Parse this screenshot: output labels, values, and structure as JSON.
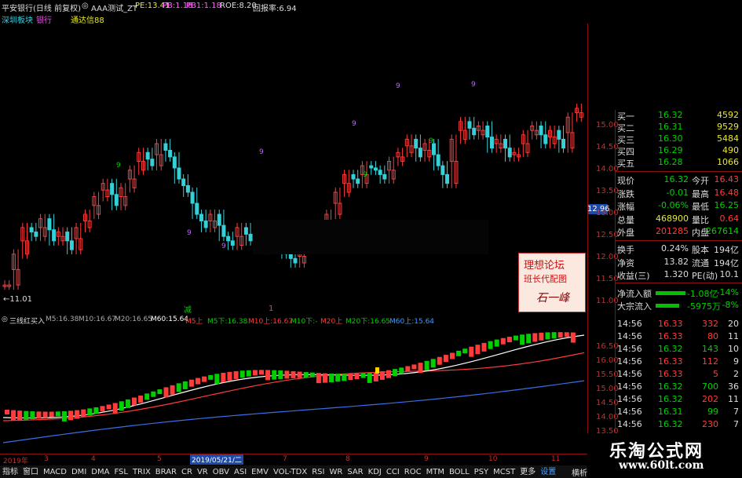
{
  "header": {
    "stock_title": "平安银行(日线 前复权)",
    "indicator_name": "AAA测试_ZT",
    "pe": "PE:13.41",
    "pb": "PB:1.18",
    "pb1": "PB1:1.18",
    "roe": "ROE:8.20",
    "ratio": "回报率:6.94",
    "sector": "深圳板块",
    "industry": "银行",
    "tdx_label": "通达信88"
  },
  "main_chart": {
    "y_ticks": [
      "15.00",
      "14.50",
      "14.00",
      "13.50",
      "13.00",
      "12.50",
      "12.00",
      "11.50",
      "11.00"
    ],
    "current_price_tag": "12.96",
    "low_label": "←11.01",
    "markers": [
      "9",
      "9",
      "9",
      "9",
      "9",
      "9",
      "9",
      "9",
      "9"
    ],
    "bottom_markers": [
      "减",
      "1"
    ]
  },
  "sub_chart": {
    "title": "三线红买入",
    "m5": "M5:16.38",
    "m10": "M10:16.67",
    "m20": "M20:16.65",
    "m60": "M60:15.64",
    "m5up": "M5上",
    "m5down": "M5下:16.38",
    "m10up": "M10上:16.67",
    "m10down": "M10下:-",
    "m20up": "M20上",
    "m20down": "M20下:16.65",
    "m60up": "M60上:15.64",
    "y_ticks": [
      "16.50",
      "16.00",
      "15.50",
      "15.00",
      "14.50",
      "14.00",
      "13.50"
    ]
  },
  "time_axis": {
    "labels": [
      "2019年",
      "3",
      "4",
      "5",
      "2019/05/21/二",
      "7",
      "8",
      "9",
      "10",
      "11"
    ]
  },
  "order_book": {
    "rows": [
      {
        "label": "买一",
        "price": "16.32",
        "vol": "4592"
      },
      {
        "label": "买二",
        "price": "16.31",
        "vol": "9529"
      },
      {
        "label": "买三",
        "price": "16.30",
        "vol": "5484"
      },
      {
        "label": "买四",
        "price": "16.29",
        "vol": "490"
      },
      {
        "label": "买五",
        "price": "16.28",
        "vol": "1066"
      }
    ],
    "right_ticks": [
      "15.00",
      "14.50",
      "14.00",
      "13.50",
      "13.00",
      "12.50",
      "12.00",
      "11.50",
      "11.00"
    ]
  },
  "quote": {
    "rows": [
      {
        "l1": "现价",
        "v1": "16.32",
        "l2": "今开",
        "v2": "16.43"
      },
      {
        "l1": "涨跌",
        "v1": "-0.01",
        "l2": "最高",
        "v2": "16.48"
      },
      {
        "l1": "涨幅",
        "v1": "-0.06%",
        "l2": "最低",
        "v2": "16.25"
      },
      {
        "l1": "总量",
        "v1": "468900",
        "l2": "量比",
        "v2": "0.64"
      },
      {
        "l1": "外盘",
        "v1": "201285",
        "l2": "内盘",
        "v2": "267614"
      }
    ],
    "fin_rows": [
      {
        "l1": "换手",
        "v1": "0.24%",
        "l2": "股本",
        "v2": "194亿"
      },
      {
        "l1": "净资",
        "v1": "13.82",
        "l2": "流通",
        "v2": "194亿"
      },
      {
        "l1": "收益(三)",
        "v1": "1.320",
        "l2": "PE(动)",
        "v2": "10.1"
      }
    ],
    "flow_rows": [
      {
        "label": "净流入额",
        "value": "-1.08亿",
        "pct": "-14%"
      },
      {
        "label": "大宗流入",
        "value": "-5975万",
        "pct": "-8%"
      }
    ]
  },
  "ticks": {
    "rows": [
      {
        "time": "14:56",
        "price": "16.33",
        "vol": "332",
        "n": "20"
      },
      {
        "time": "14:56",
        "price": "16.33",
        "vol": "80",
        "n": "11"
      },
      {
        "time": "14:56",
        "price": "16.32",
        "vol": "143",
        "n": "10"
      },
      {
        "time": "14:56",
        "price": "16.33",
        "vol": "112",
        "n": "9"
      },
      {
        "time": "14:56",
        "price": "16.33",
        "vol": "5",
        "n": "2"
      },
      {
        "time": "14:56",
        "price": "16.32",
        "vol": "700",
        "n": "36"
      },
      {
        "time": "14:56",
        "price": "16.32",
        "vol": "202",
        "n": "11"
      },
      {
        "time": "14:56",
        "price": "16.31",
        "vol": "99",
        "n": "7"
      },
      {
        "time": "14:56",
        "price": "16.32",
        "vol": "230",
        "n": "7"
      }
    ]
  },
  "watermark": {
    "forum_line1": "理想论坛",
    "forum_line2": "班长代配图",
    "signature": "石一峰",
    "site_name": "乐淘公式网",
    "site_url": "www.60lt.com"
  },
  "toolbar": {
    "items": [
      "指标",
      "窗口",
      "MACD",
      "DMI",
      "DMA",
      "FSL",
      "TRIX",
      "BRAR",
      "CR",
      "VR",
      "OBV",
      "ASI",
      "EMV",
      "VOL-TDX",
      "RSI",
      "WR",
      "SAR",
      "KDJ",
      "CCI",
      "ROC",
      "MTM",
      "BOLL",
      "PSY",
      "MCST",
      "更多",
      "设置"
    ],
    "right_label": "横析"
  },
  "colors": {
    "up": "#ff3b3b",
    "down": "#35d0d8",
    "green": "#00d000",
    "ma_blue": "#3a6ee8",
    "yellow": "#ffd200",
    "white": "#ffffff"
  }
}
